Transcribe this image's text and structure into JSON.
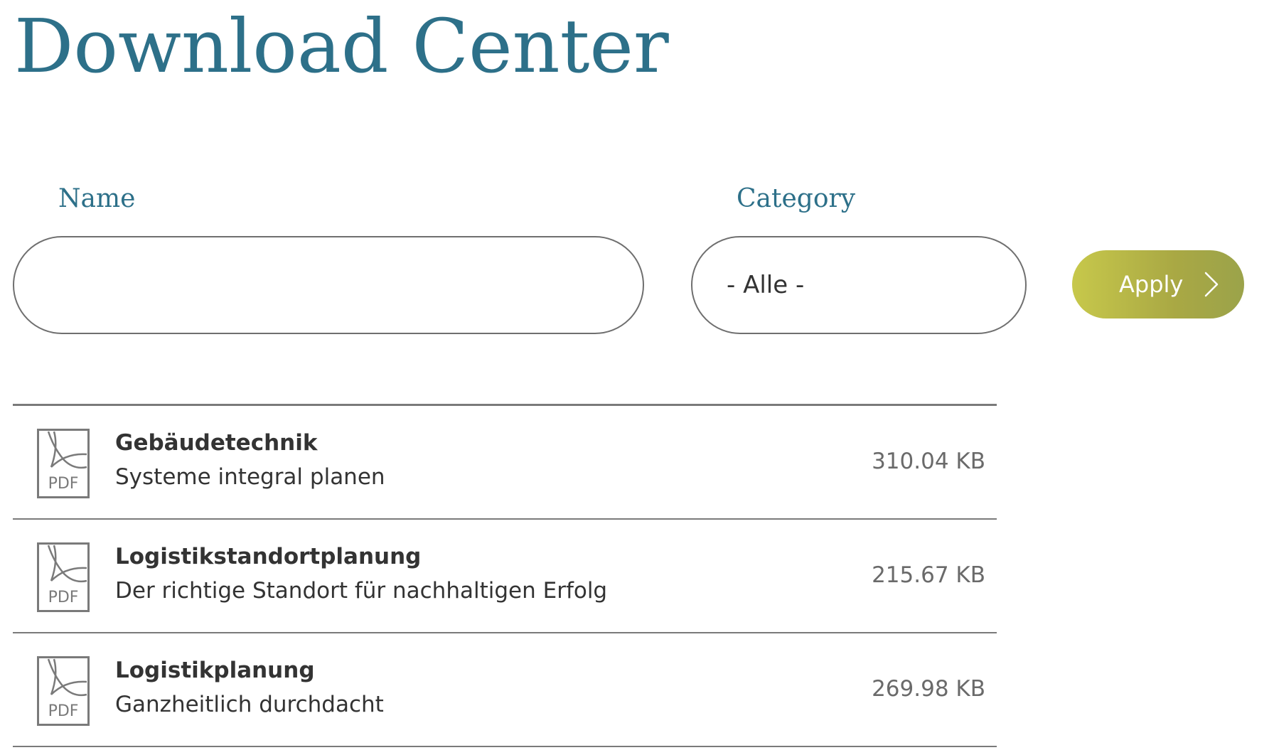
{
  "page": {
    "title": "Download Center"
  },
  "filters": {
    "name_label": "Name",
    "name_value": "",
    "category_label": "Category",
    "category_selected": "- Alle -",
    "apply_label": "Apply"
  },
  "colors": {
    "title": "#2d7089",
    "apply_gradient_start": "#c7c84b",
    "apply_gradient_end": "#9ba34a",
    "rule": "#7a7a7a"
  },
  "downloads": [
    {
      "icon": "pdf-icon",
      "icon_label": "PDF",
      "title": "Gebäudetechnik",
      "subtitle": "Systeme integral planen",
      "size": "310.04 KB"
    },
    {
      "icon": "pdf-icon",
      "icon_label": "PDF",
      "title": "Logistikstandortplanung",
      "subtitle": "Der richtige Standort für nachhaltigen Erfolg",
      "size": "215.67 KB"
    },
    {
      "icon": "pdf-icon",
      "icon_label": "PDF",
      "title": "Logistikplanung",
      "subtitle": "Ganzheitlich durchdacht",
      "size": "269.98 KB"
    }
  ]
}
